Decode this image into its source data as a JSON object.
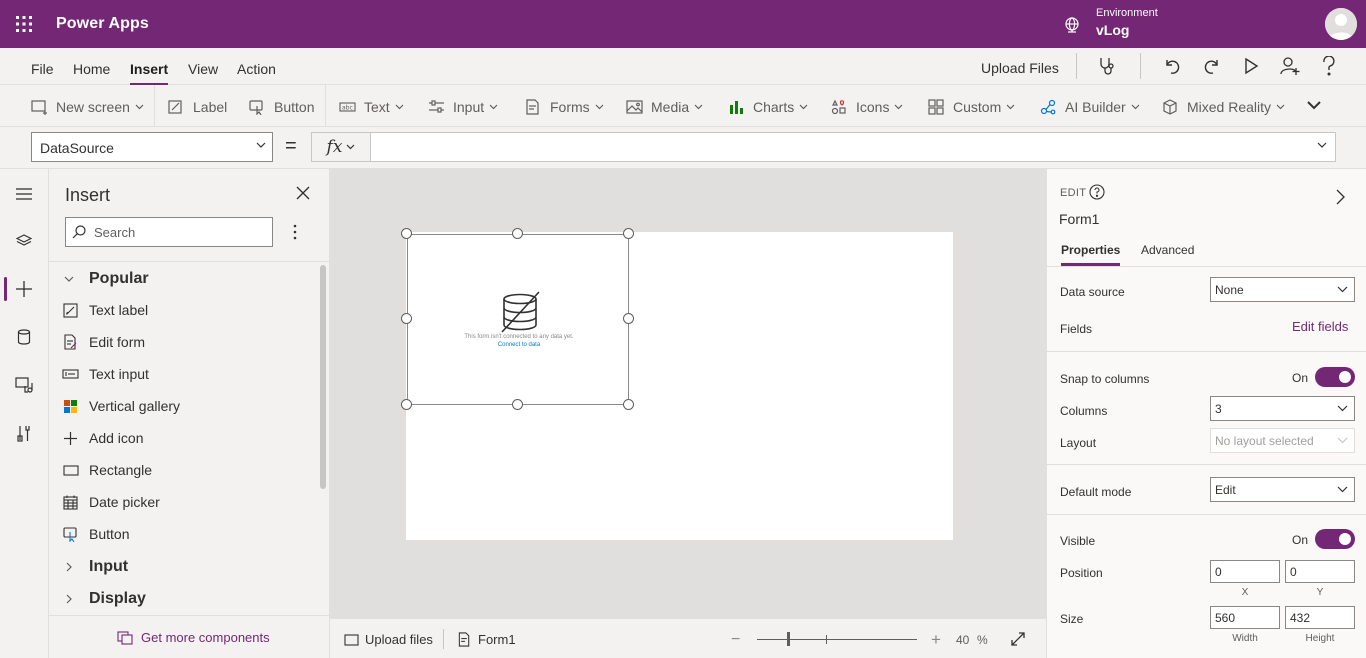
{
  "app": {
    "name": "Power Apps"
  },
  "environment": {
    "label": "Environment",
    "name": "vLog"
  },
  "menu": {
    "items": [
      "File",
      "Home",
      "Insert",
      "View",
      "Action"
    ],
    "active": "Insert",
    "upload_files": "Upload Files"
  },
  "ribbon": {
    "new_screen": "New screen",
    "label": "Label",
    "button": "Button",
    "text": "Text",
    "input": "Input",
    "forms": "Forms",
    "media": "Media",
    "charts": "Charts",
    "icons": "Icons",
    "custom": "Custom",
    "ai_builder": "AI Builder",
    "mixed_reality": "Mixed Reality"
  },
  "formula_bar": {
    "property": "DataSource",
    "equals": "=",
    "fx": "fx",
    "formula": ""
  },
  "insert_panel": {
    "title": "Insert",
    "search_placeholder": "Search",
    "popular_label": "Popular",
    "items": [
      {
        "label": "Text label",
        "icon": "text-label-icon"
      },
      {
        "label": "Edit form",
        "icon": "edit-form-icon"
      },
      {
        "label": "Text input",
        "icon": "text-input-icon"
      },
      {
        "label": "Vertical gallery",
        "icon": "gallery-icon"
      },
      {
        "label": "Add icon",
        "icon": "add-icon"
      },
      {
        "label": "Rectangle",
        "icon": "rectangle-icon"
      },
      {
        "label": "Date picker",
        "icon": "calendar-icon"
      },
      {
        "label": "Button",
        "icon": "button-icon"
      }
    ],
    "categories": [
      "Input",
      "Display"
    ],
    "get_more": "Get more components"
  },
  "canvas": {
    "form_message": "This form isn't connected to any data yet.",
    "connect_link": "Connect to data"
  },
  "status_bar": {
    "upload_files": "Upload files",
    "screen_tab": "Form1",
    "zoom_value": "40",
    "zoom_unit": "%"
  },
  "properties": {
    "edit_label": "EDIT",
    "control_name": "Form1",
    "tabs": [
      "Properties",
      "Advanced"
    ],
    "data_source_label": "Data source",
    "data_source_value": "None",
    "fields_label": "Fields",
    "edit_fields": "Edit fields",
    "snap_label": "Snap to columns",
    "snap_state": "On",
    "columns_label": "Columns",
    "columns_value": "3",
    "layout_label": "Layout",
    "layout_placeholder": "No layout selected",
    "default_mode_label": "Default mode",
    "default_mode_value": "Edit",
    "visible_label": "Visible",
    "visible_state": "On",
    "position_label": "Position",
    "x": "0",
    "y": "0",
    "x_caption": "X",
    "y_caption": "Y",
    "size_label": "Size",
    "width": "560",
    "height": "432",
    "width_caption": "Width",
    "height_caption": "Height"
  },
  "colors": {
    "brand": "#742774",
    "chrome": "#f3f2f1",
    "canvas_bg": "#e1dfdd",
    "link": "#0078d4"
  }
}
